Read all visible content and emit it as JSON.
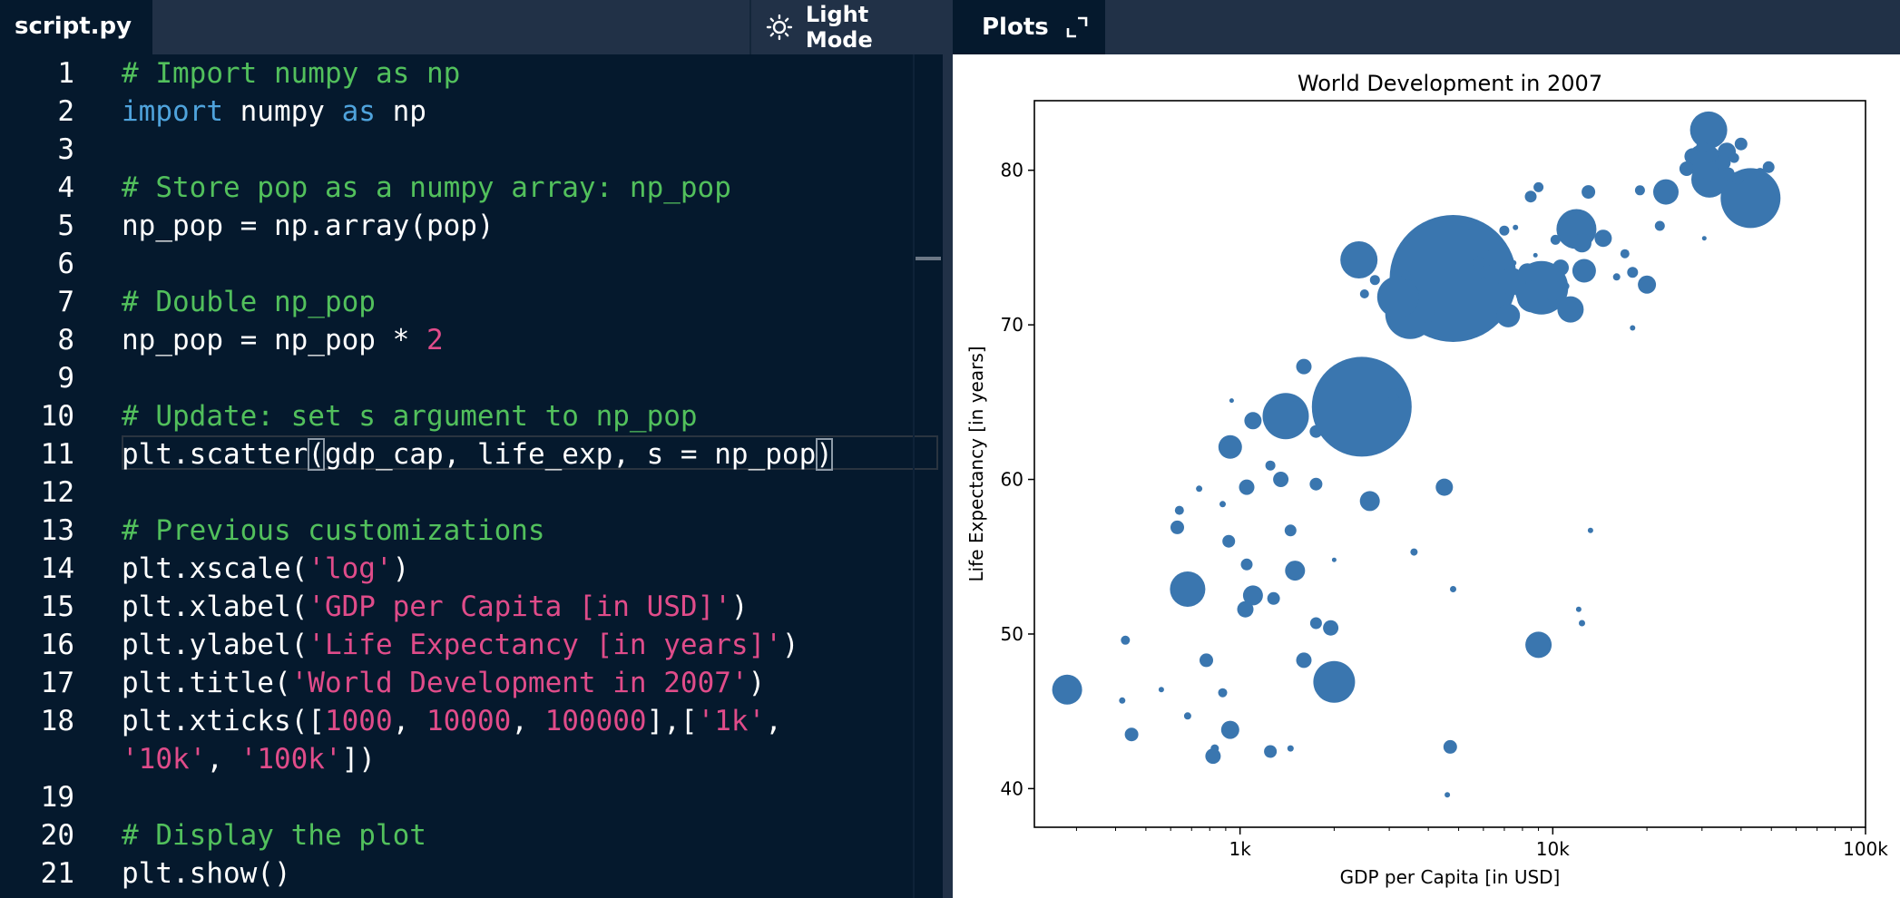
{
  "editor": {
    "tab_label": "script.py",
    "light_mode_label": "Light Mode",
    "lines": [
      {
        "n": "1",
        "tokens": [
          {
            "t": "# Import numpy as np",
            "c": "cm"
          }
        ]
      },
      {
        "n": "2",
        "tokens": [
          {
            "t": "import",
            "c": "kw"
          },
          {
            "t": " numpy "
          },
          {
            "t": "as",
            "c": "kw"
          },
          {
            "t": " np"
          }
        ]
      },
      {
        "n": "3",
        "tokens": []
      },
      {
        "n": "4",
        "tokens": [
          {
            "t": "# Store pop as a numpy array: np_pop",
            "c": "cm"
          }
        ]
      },
      {
        "n": "5",
        "tokens": [
          {
            "t": "np_pop = np.array(pop)"
          }
        ]
      },
      {
        "n": "6",
        "tokens": []
      },
      {
        "n": "7",
        "tokens": [
          {
            "t": "# Double np_pop",
            "c": "cm"
          }
        ]
      },
      {
        "n": "8",
        "tokens": [
          {
            "t": "np_pop = np_pop * "
          },
          {
            "t": "2",
            "c": "num"
          }
        ]
      },
      {
        "n": "9",
        "tokens": []
      },
      {
        "n": "10",
        "tokens": [
          {
            "t": "# Update: set s argument to np_pop",
            "c": "cm"
          }
        ]
      },
      {
        "n": "11",
        "tokens": [
          {
            "t": "plt.scatter"
          },
          {
            "t": "(",
            "c": "bracket"
          },
          {
            "t": "gdp_cap, life_exp, s = np_pop"
          },
          {
            "t": ")",
            "c": "bracket"
          }
        ]
      },
      {
        "n": "12",
        "tokens": []
      },
      {
        "n": "13",
        "tokens": [
          {
            "t": "# Previous customizations",
            "c": "cm"
          }
        ]
      },
      {
        "n": "14",
        "tokens": [
          {
            "t": "plt.xscale("
          },
          {
            "t": "'log'",
            "c": "str"
          },
          {
            "t": ")"
          }
        ]
      },
      {
        "n": "15",
        "tokens": [
          {
            "t": "plt.xlabel("
          },
          {
            "t": "'GDP per Capita [in USD]'",
            "c": "str"
          },
          {
            "t": ")"
          }
        ]
      },
      {
        "n": "16",
        "tokens": [
          {
            "t": "plt.ylabel("
          },
          {
            "t": "'Life Expectancy [in years]'",
            "c": "str"
          },
          {
            "t": ")"
          }
        ]
      },
      {
        "n": "17",
        "tokens": [
          {
            "t": "plt.title("
          },
          {
            "t": "'World Development in 2007'",
            "c": "str"
          },
          {
            "t": ")"
          }
        ]
      },
      {
        "n": "18",
        "tokens": [
          {
            "t": "plt.xticks(["
          },
          {
            "t": "1000",
            "c": "num"
          },
          {
            "t": ", "
          },
          {
            "t": "10000",
            "c": "num"
          },
          {
            "t": ", "
          },
          {
            "t": "100000",
            "c": "num"
          },
          {
            "t": "],["
          },
          {
            "t": "'1k'",
            "c": "str"
          },
          {
            "t": ","
          }
        ]
      },
      {
        "n": "",
        "tokens": [
          {
            "t": "'10k'",
            "c": "str"
          },
          {
            "t": ", "
          },
          {
            "t": "'100k'",
            "c": "str"
          },
          {
            "t": "])"
          }
        ]
      },
      {
        "n": "19",
        "tokens": []
      },
      {
        "n": "20",
        "tokens": [
          {
            "t": "# Display the plot",
            "c": "cm"
          }
        ]
      },
      {
        "n": "21",
        "tokens": [
          {
            "t": "plt.show()"
          }
        ]
      }
    ]
  },
  "plots": {
    "tab_label": "Plots"
  },
  "chart_data": {
    "type": "scatter",
    "title": "World Development in 2007",
    "xlabel": "GDP per Capita [in USD]",
    "ylabel": "Life Expectancy [in years]",
    "xscale": "log",
    "xlim": [
      220,
      100000
    ],
    "ylim": [
      37.5,
      84.5
    ],
    "xticks": [
      {
        "value": 1000,
        "label": "1k"
      },
      {
        "value": 10000,
        "label": "10k"
      },
      {
        "value": 100000,
        "label": "100k"
      }
    ],
    "yticks": [
      40,
      50,
      60,
      70,
      80
    ],
    "grid": false,
    "marker_color": "#3A76AF",
    "points": [
      {
        "x": 4800,
        "y": 73,
        "s": 140
      },
      {
        "x": 2450,
        "y": 64.7,
        "s": 110
      },
      {
        "x": 31500,
        "y": 82.6,
        "s": 41
      },
      {
        "x": 42900,
        "y": 78.2,
        "s": 66
      },
      {
        "x": 11900,
        "y": 76.2,
        "s": 44
      },
      {
        "x": 9200,
        "y": 72.4,
        "s": 59
      },
      {
        "x": 3500,
        "y": 70.7,
        "s": 55
      },
      {
        "x": 3200,
        "y": 71.8,
        "s": 46
      },
      {
        "x": 2400,
        "y": 74.2,
        "s": 41
      },
      {
        "x": 1400,
        "y": 64.1,
        "s": 51
      },
      {
        "x": 2000,
        "y": 46.9,
        "s": 46
      },
      {
        "x": 680,
        "y": 52.9,
        "s": 39
      },
      {
        "x": 280,
        "y": 46.4,
        "s": 33
      },
      {
        "x": 9000,
        "y": 49.3,
        "s": 29
      },
      {
        "x": 31700,
        "y": 79.4,
        "s": 40
      },
      {
        "x": 30500,
        "y": 80.6,
        "s": 38
      },
      {
        "x": 33000,
        "y": 79.9,
        "s": 24
      },
      {
        "x": 23000,
        "y": 78.6,
        "s": 28
      },
      {
        "x": 7400,
        "y": 72.8,
        "s": 30
      },
      {
        "x": 7200,
        "y": 70.6,
        "s": 26
      },
      {
        "x": 11400,
        "y": 71.0,
        "s": 29
      },
      {
        "x": 12600,
        "y": 73.5,
        "s": 26
      },
      {
        "x": 8600,
        "y": 71.8,
        "s": 34
      },
      {
        "x": 10000,
        "y": 72.2,
        "s": 22
      },
      {
        "x": 930,
        "y": 62.1,
        "s": 26
      },
      {
        "x": 1100,
        "y": 52.5,
        "s": 22
      },
      {
        "x": 2600,
        "y": 58.6,
        "s": 22
      },
      {
        "x": 1500,
        "y": 54.1,
        "s": 22
      },
      {
        "x": 1040,
        "y": 51.6,
        "s": 18
      },
      {
        "x": 930,
        "y": 43.8,
        "s": 20
      },
      {
        "x": 4500,
        "y": 59.5,
        "s": 19
      },
      {
        "x": 1600,
        "y": 48.3,
        "s": 17
      },
      {
        "x": 20000,
        "y": 72.6,
        "s": 20
      },
      {
        "x": 36000,
        "y": 81.2,
        "s": 20
      },
      {
        "x": 28000,
        "y": 80.9,
        "s": 18
      },
      {
        "x": 35000,
        "y": 80.5,
        "s": 17
      },
      {
        "x": 26800,
        "y": 80.1,
        "s": 16
      },
      {
        "x": 14500,
        "y": 75.6,
        "s": 19
      },
      {
        "x": 12400,
        "y": 75.3,
        "s": 21
      },
      {
        "x": 8300,
        "y": 73.4,
        "s": 20
      },
      {
        "x": 6100,
        "y": 74.3,
        "s": 18
      },
      {
        "x": 10600,
        "y": 73.7,
        "s": 18
      },
      {
        "x": 1600,
        "y": 67.3,
        "s": 17
      },
      {
        "x": 1100,
        "y": 63.8,
        "s": 19
      },
      {
        "x": 1350,
        "y": 60.0,
        "s": 17
      },
      {
        "x": 1050,
        "y": 59.5,
        "s": 17
      },
      {
        "x": 1750,
        "y": 59.7,
        "s": 14
      },
      {
        "x": 1280,
        "y": 52.3,
        "s": 14
      },
      {
        "x": 1950,
        "y": 50.4,
        "s": 17
      },
      {
        "x": 820,
        "y": 42.1,
        "s": 17
      },
      {
        "x": 1250,
        "y": 42.4,
        "s": 14
      },
      {
        "x": 450,
        "y": 43.5,
        "s": 15
      },
      {
        "x": 4700,
        "y": 42.7,
        "s": 15
      },
      {
        "x": 1750,
        "y": 50.7,
        "s": 13
      },
      {
        "x": 780,
        "y": 48.3,
        "s": 15
      },
      {
        "x": 920,
        "y": 56.0,
        "s": 14
      },
      {
        "x": 630,
        "y": 56.9,
        "s": 15
      },
      {
        "x": 1050,
        "y": 54.5,
        "s": 13
      },
      {
        "x": 1450,
        "y": 56.7,
        "s": 13
      },
      {
        "x": 3100,
        "y": 65.5,
        "s": 13
      },
      {
        "x": 1250,
        "y": 60.9,
        "s": 11
      },
      {
        "x": 1750,
        "y": 63.1,
        "s": 14
      },
      {
        "x": 3300,
        "y": 65.6,
        "s": 12
      },
      {
        "x": 5800,
        "y": 74.0,
        "s": 14
      },
      {
        "x": 18000,
        "y": 73.4,
        "s": 12
      },
      {
        "x": 13000,
        "y": 78.6,
        "s": 15
      },
      {
        "x": 8500,
        "y": 78.3,
        "s": 13
      },
      {
        "x": 39000,
        "y": 79.5,
        "s": 14
      },
      {
        "x": 40000,
        "y": 81.7,
        "s": 14
      },
      {
        "x": 46000,
        "y": 79.8,
        "s": 12
      },
      {
        "x": 49000,
        "y": 80.2,
        "s": 13
      },
      {
        "x": 36500,
        "y": 79.8,
        "s": 13
      },
      {
        "x": 30000,
        "y": 81.5,
        "s": 13
      },
      {
        "x": 27000,
        "y": 80.2,
        "s": 12
      },
      {
        "x": 22000,
        "y": 76.4,
        "s": 11
      },
      {
        "x": 19000,
        "y": 78.7,
        "s": 11
      },
      {
        "x": 38000,
        "y": 80.8,
        "s": 11
      },
      {
        "x": 17000,
        "y": 74.6,
        "s": 10
      },
      {
        "x": 9000,
        "y": 78.9,
        "s": 11
      },
      {
        "x": 7000,
        "y": 76.1,
        "s": 11
      },
      {
        "x": 10200,
        "y": 75.5,
        "s": 11
      },
      {
        "x": 5500,
        "y": 76.4,
        "s": 10
      },
      {
        "x": 3400,
        "y": 73.2,
        "s": 10
      },
      {
        "x": 2700,
        "y": 72.9,
        "s": 11
      },
      {
        "x": 2500,
        "y": 72.0,
        "s": 10
      },
      {
        "x": 640,
        "y": 58.0,
        "s": 10
      },
      {
        "x": 430,
        "y": 49.6,
        "s": 10
      },
      {
        "x": 880,
        "y": 46.2,
        "s": 10
      },
      {
        "x": 830,
        "y": 42.6,
        "s": 9
      },
      {
        "x": 1450,
        "y": 42.6,
        "s": 7
      },
      {
        "x": 680,
        "y": 44.7,
        "s": 8
      },
      {
        "x": 420,
        "y": 45.7,
        "s": 7
      },
      {
        "x": 560,
        "y": 46.4,
        "s": 6
      },
      {
        "x": 880,
        "y": 58.4,
        "s": 7
      },
      {
        "x": 740,
        "y": 59.4,
        "s": 7
      },
      {
        "x": 3600,
        "y": 55.3,
        "s": 8
      },
      {
        "x": 4800,
        "y": 52.9,
        "s": 7
      },
      {
        "x": 12400,
        "y": 50.7,
        "s": 7
      },
      {
        "x": 12100,
        "y": 51.6,
        "s": 6
      },
      {
        "x": 13200,
        "y": 56.7,
        "s": 6
      },
      {
        "x": 4600,
        "y": 39.6,
        "s": 6
      },
      {
        "x": 2000,
        "y": 54.8,
        "s": 5
      },
      {
        "x": 1500,
        "y": 65.2,
        "s": 6
      },
      {
        "x": 940,
        "y": 65.1,
        "s": 5
      },
      {
        "x": 18000,
        "y": 69.8,
        "s": 6
      },
      {
        "x": 30500,
        "y": 75.6,
        "s": 5
      },
      {
        "x": 7600,
        "y": 76.3,
        "s": 6
      },
      {
        "x": 8800,
        "y": 74.5,
        "s": 5
      },
      {
        "x": 7500,
        "y": 74.0,
        "s": 6
      },
      {
        "x": 16000,
        "y": 73.1,
        "s": 8
      },
      {
        "x": 11000,
        "y": 72.5,
        "s": 8
      },
      {
        "x": 6000,
        "y": 72.9,
        "s": 7
      },
      {
        "x": 4000,
        "y": 70.1,
        "s": 8
      }
    ]
  }
}
